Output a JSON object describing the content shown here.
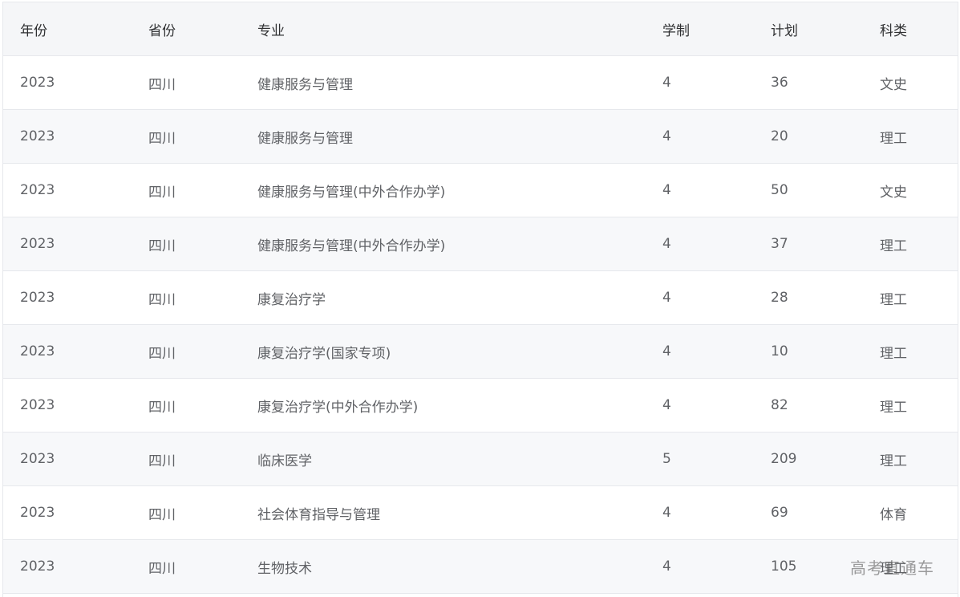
{
  "headers": [
    "年份",
    "省份",
    "专业",
    "学制",
    "计划",
    "科类"
  ],
  "rows": [
    [
      "2023",
      "四川",
      "健康服务与管理",
      "4",
      "36",
      "文史"
    ],
    [
      "2023",
      "四川",
      "健康服务与管理",
      "4",
      "20",
      "理工"
    ],
    [
      "2023",
      "四川",
      "健康服务与管理(中外合作办学)",
      "4",
      "50",
      "文史"
    ],
    [
      "2023",
      "四川",
      "健康服务与管理(中外合作办学)",
      "4",
      "37",
      "理工"
    ],
    [
      "2023",
      "四川",
      "康复治疗学",
      "4",
      "28",
      "理工"
    ],
    [
      "2023",
      "四川",
      "康复治疗学(国家专项)",
      "4",
      "10",
      "理工"
    ],
    [
      "2023",
      "四川",
      "康复治疗学(中外合作办学)",
      "4",
      "82",
      "理工"
    ],
    [
      "2023",
      "四川",
      "临床医学",
      "5",
      "209",
      "理工"
    ],
    [
      "2023",
      "四川",
      "社会体育指导与管理",
      "4",
      "69",
      "体育"
    ],
    [
      "2023",
      "四川",
      "生物技术",
      "4",
      "105",
      "理工"
    ]
  ],
  "watermark": "高考直通车"
}
